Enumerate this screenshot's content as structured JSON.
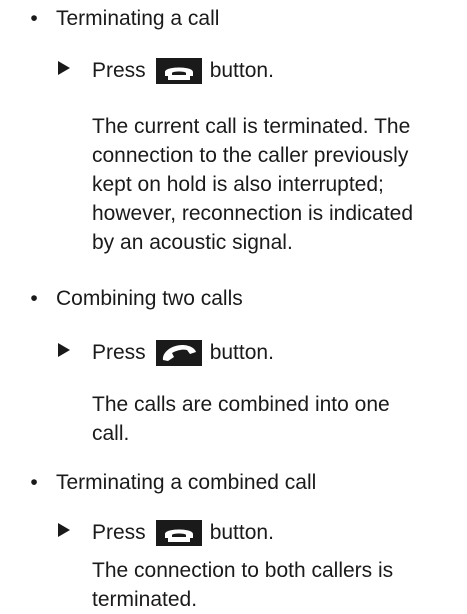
{
  "items": [
    {
      "bullet": "•",
      "title": "Terminating a call",
      "step": {
        "arrow": "▶",
        "prefix": "Press",
        "icon": "end-call-icon",
        "suffix": "button."
      },
      "result_lines": [
        "The current call is terminated. The",
        "connection to the caller previously",
        "kept on hold is also interrupted;",
        "however, reconnection is indicated",
        "by an acoustic signal."
      ]
    },
    {
      "bullet": "•",
      "title": "Combining two calls",
      "step": {
        "arrow": "▶",
        "prefix": "Press",
        "icon": "call-icon",
        "suffix": "button."
      },
      "result_lines": [
        "The calls are combined into one",
        "call."
      ]
    },
    {
      "bullet": "•",
      "title": "Terminating a combined call",
      "step": {
        "arrow": "▶",
        "prefix": "Press",
        "icon": "end-call-icon",
        "suffix": "button."
      },
      "result_lines": [
        "The connection to both callers is",
        "terminated."
      ]
    }
  ]
}
